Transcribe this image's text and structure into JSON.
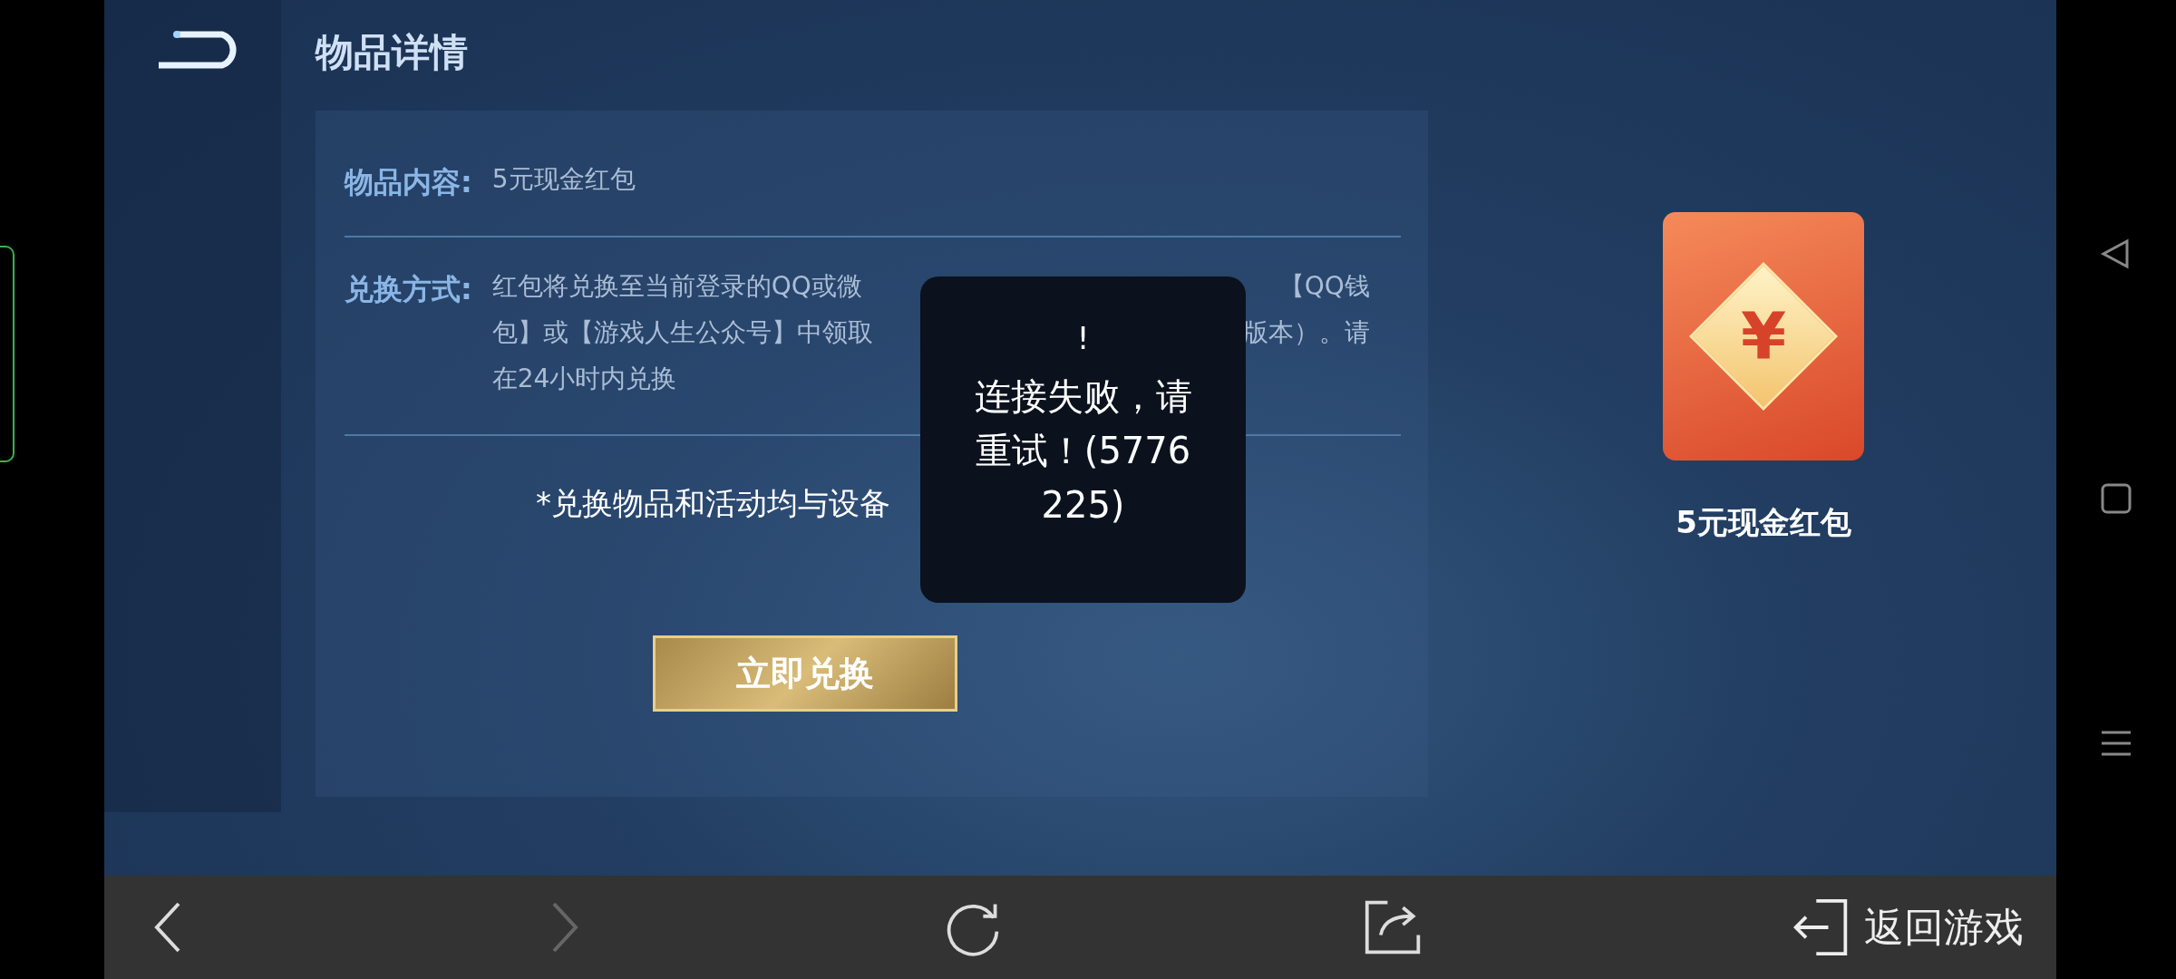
{
  "header": {
    "title": "物品详情"
  },
  "details": [
    {
      "label": "物品内容:",
      "value": "5元现金红包"
    },
    {
      "label": "兑换方式:",
      "lines": [
        {
          "left": "红包将兑换至当前登录的QQ或微",
          "right": "【QQ钱"
        },
        {
          "left": "包】或【游戏人生公众号】中领取",
          "right": "版本）。请"
        },
        {
          "left": "在24小时内兑换"
        }
      ]
    }
  ],
  "disclaimer": "*兑换物品和活动均与设备",
  "redeem_button": "立即兑换",
  "prize": {
    "caption": "5元现金红包",
    "symbol": "¥"
  },
  "toast": {
    "mark": "!",
    "message": "连接失败，请重试！(5776225)"
  },
  "bottom_bar": [
    {
      "kind": "back",
      "disabled": false
    },
    {
      "kind": "forward",
      "disabled": true
    },
    {
      "kind": "refresh",
      "disabled": false
    },
    {
      "kind": "share",
      "disabled": false
    },
    {
      "kind": "exit",
      "label": "返回游戏",
      "disabled": false
    }
  ]
}
